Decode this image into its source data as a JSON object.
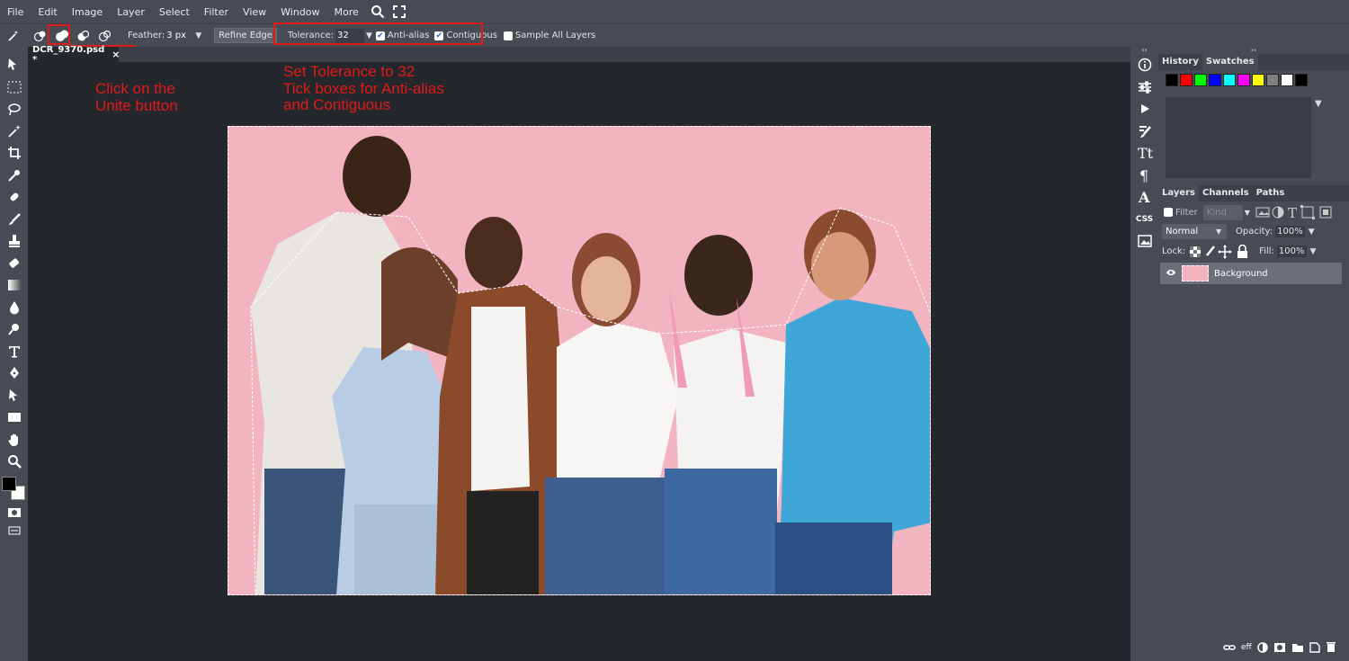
{
  "menu": [
    "File",
    "Edit",
    "Image",
    "Layer",
    "Select",
    "Filter",
    "View",
    "Window",
    "More"
  ],
  "options": {
    "feather_label": "Feather:",
    "feather_value": "3 px",
    "refine_edge": "Refine Edge",
    "tolerance_label": "Tolerance:",
    "tolerance_value": "32",
    "anti_alias": "Anti-alias",
    "anti_alias_checked": true,
    "contiguous": "Contiguous",
    "contiguous_checked": true,
    "sample_all_layers": "Sample All Layers",
    "sample_all_checked": false
  },
  "document": {
    "tab_title": "DCR_9370.psd *",
    "close": "×"
  },
  "annotations": {
    "unite": "Click on the\nUnite button",
    "tolerance": "Set Tolerance to 32\nTick boxes for Anti-alias\nand Contiguous"
  },
  "history_panel": {
    "tabs": [
      "History",
      "Swatches"
    ],
    "swatches": [
      "#000000",
      "#ff0000",
      "#00ff00",
      "#0000ff",
      "#00ffff",
      "#ff00ff",
      "#ffff00",
      "#808080",
      "#ffffff",
      "#000000"
    ]
  },
  "layers_panel": {
    "tabs": [
      "Layers",
      "Channels",
      "Paths"
    ],
    "filter_label": "Filter",
    "kind_placeholder": "Kind",
    "blend_mode": "Normal",
    "opacity_label": "Opacity:",
    "opacity_value": "100%",
    "lock_label": "Lock:",
    "fill_label": "Fill:",
    "fill_value": "100%",
    "layer_name": "Background",
    "footer_eff": "eff"
  },
  "right_toolbar_labels": {
    "css": "CSS"
  },
  "colors": {
    "highlight": "#e11a1a",
    "panel": "#474b53",
    "canvas": "#24272c",
    "photo_bg": "#f2b4c1"
  }
}
